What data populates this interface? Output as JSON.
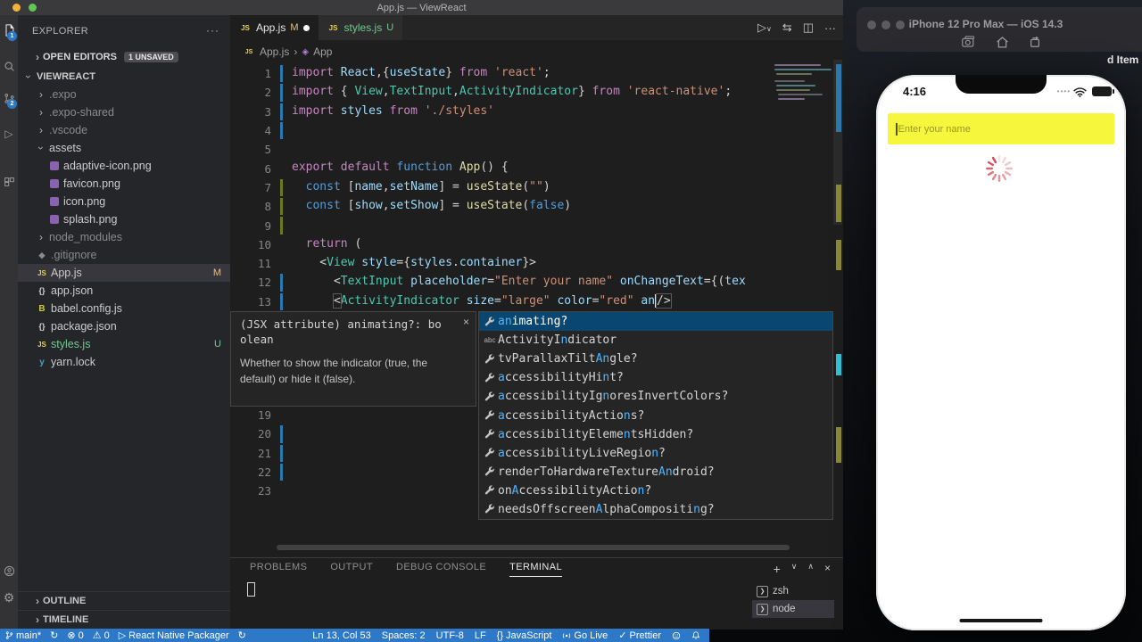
{
  "window": {
    "title": "App.js — ViewReact"
  },
  "colors": {
    "accent": "#2d79c7",
    "selection": "#094771",
    "phone_input_yellow": "#f6f63c",
    "spinner_red": "#cf4a55"
  },
  "activity_bar": {
    "explorer_badge": "1",
    "scm_badge": "2"
  },
  "sidebar": {
    "header": "EXPLORER",
    "open_editors": {
      "label": "OPEN EDITORS",
      "badge": "1 UNSAVED"
    },
    "tree": [
      {
        "label": "VIEWREACT",
        "chev": "open",
        "root": true
      },
      {
        "label": ".expo",
        "chev": "closed",
        "dim": true,
        "indent": 1
      },
      {
        "label": ".expo-shared",
        "chev": "closed",
        "dim": true,
        "indent": 1
      },
      {
        "label": ".vscode",
        "chev": "closed",
        "dim": true,
        "indent": 1
      },
      {
        "label": "assets",
        "chev": "open",
        "indent": 1
      },
      {
        "label": "adaptive-icon.png",
        "icon": "image-icon",
        "indent": 2
      },
      {
        "label": "favicon.png",
        "icon": "image-icon",
        "indent": 2
      },
      {
        "label": "icon.png",
        "icon": "image-icon",
        "indent": 2
      },
      {
        "label": "splash.png",
        "icon": "image-icon",
        "indent": 2
      },
      {
        "label": "node_modules",
        "chev": "closed",
        "dim": true,
        "indent": 1
      },
      {
        "label": ".gitignore",
        "icon": "git-icon",
        "dim": true,
        "indent": 1
      },
      {
        "label": "App.js",
        "icon": "js-icon",
        "selected": true,
        "badge": "M",
        "badge_color": "#e2c08d",
        "indent": 1
      },
      {
        "label": "app.json",
        "icon": "json-icon",
        "indent": 1
      },
      {
        "label": "babel.config.js",
        "icon": "babel-icon",
        "indent": 1
      },
      {
        "label": "package.json",
        "icon": "json-icon",
        "indent": 1
      },
      {
        "label": "styles.js",
        "icon": "js-icon",
        "color": "#73c991",
        "badge": "U",
        "badge_color": "#73c991",
        "indent": 1
      },
      {
        "label": "yarn.lock",
        "icon": "yarn-icon",
        "indent": 1
      }
    ],
    "outline": "OUTLINE",
    "timeline": "TIMELINE"
  },
  "tabs": {
    "tab1": {
      "label": "App.js",
      "badge": "M"
    },
    "tab2": {
      "label": "styles.js",
      "badge": "U"
    }
  },
  "breadcrumb": {
    "file": "App.js",
    "separator": "›",
    "symbol": "App"
  },
  "code": {
    "lines": [
      {
        "n": "1",
        "mk": "mod",
        "segs": [
          [
            "import ",
            "kw"
          ],
          [
            "React",
            "var"
          ],
          [
            ",{",
            "punc"
          ],
          [
            "useState",
            "var"
          ],
          [
            "} ",
            "punc"
          ],
          [
            "from",
            "kw"
          ],
          [
            " ",
            "punc"
          ],
          [
            "'react'",
            "str"
          ],
          [
            ";",
            "punc"
          ]
        ]
      },
      {
        "n": "2",
        "mk": "mod",
        "segs": [
          [
            "import ",
            "kw"
          ],
          [
            "{ ",
            "punc"
          ],
          [
            "View",
            "type"
          ],
          [
            ",",
            "punc"
          ],
          [
            "TextInput",
            "type"
          ],
          [
            ",",
            "punc"
          ],
          [
            "ActivityIndicator",
            "type"
          ],
          [
            "} ",
            "punc"
          ],
          [
            "from",
            "kw"
          ],
          [
            " ",
            "punc"
          ],
          [
            "'react-native'",
            "str"
          ],
          [
            ";",
            "punc"
          ]
        ]
      },
      {
        "n": "3",
        "mk": "mod",
        "segs": [
          [
            "import ",
            "kw"
          ],
          [
            "styles",
            "var"
          ],
          [
            " ",
            "punc"
          ],
          [
            "from",
            "kw"
          ],
          [
            " ",
            "punc"
          ],
          [
            "'./styles'",
            "str"
          ]
        ]
      },
      {
        "n": "4",
        "mk": "mod",
        "segs": []
      },
      {
        "n": "5",
        "segs": []
      },
      {
        "n": "6",
        "segs": [
          [
            "export",
            "kw"
          ],
          [
            " ",
            "punc"
          ],
          [
            "default",
            "kw"
          ],
          [
            " ",
            "punc"
          ],
          [
            "function",
            "ctrl"
          ],
          [
            " ",
            "punc"
          ],
          [
            "App",
            "fn"
          ],
          [
            "() {",
            "punc"
          ]
        ]
      },
      {
        "n": "7",
        "mk": "add",
        "segs": [
          [
            "  ",
            "punc"
          ],
          [
            "const",
            "ctrl"
          ],
          [
            " [",
            "punc"
          ],
          [
            "name",
            "var"
          ],
          [
            ",",
            "punc"
          ],
          [
            "setName",
            "var"
          ],
          [
            "] = ",
            "punc"
          ],
          [
            "useState",
            "fn"
          ],
          [
            "(",
            "punc"
          ],
          [
            "\"\"",
            "str"
          ],
          [
            ")",
            "punc"
          ]
        ]
      },
      {
        "n": "8",
        "mk": "add",
        "segs": [
          [
            "  ",
            "punc"
          ],
          [
            "const",
            "ctrl"
          ],
          [
            " [",
            "punc"
          ],
          [
            "show",
            "var"
          ],
          [
            ",",
            "punc"
          ],
          [
            "setShow",
            "var"
          ],
          [
            "] = ",
            "punc"
          ],
          [
            "useState",
            "fn"
          ],
          [
            "(",
            "punc"
          ],
          [
            "false",
            "ctrl"
          ],
          [
            ")",
            "punc"
          ]
        ]
      },
      {
        "n": "9",
        "mk": "add",
        "segs": []
      },
      {
        "n": "10",
        "segs": [
          [
            "  ",
            "punc"
          ],
          [
            "return",
            "kw"
          ],
          [
            " (",
            "punc"
          ]
        ]
      },
      {
        "n": "11",
        "segs": [
          [
            "    <",
            "punc"
          ],
          [
            "View",
            "type"
          ],
          [
            " ",
            "punc"
          ],
          [
            "style",
            "attr"
          ],
          [
            "={",
            "punc"
          ],
          [
            "styles",
            "var"
          ],
          [
            ".",
            "punc"
          ],
          [
            "container",
            "var"
          ],
          [
            "}>",
            "punc"
          ]
        ]
      },
      {
        "n": "12",
        "mk": "mod",
        "segs": [
          [
            "      <",
            "punc"
          ],
          [
            "TextInput",
            "type"
          ],
          [
            " ",
            "punc"
          ],
          [
            "placeholder",
            "attr"
          ],
          [
            "=",
            "punc"
          ],
          [
            "\"Enter your name\"",
            "str"
          ],
          [
            " ",
            "punc"
          ],
          [
            "onChangeText",
            "attr"
          ],
          [
            "={(",
            "punc"
          ],
          [
            "tex",
            "var"
          ]
        ]
      },
      {
        "n": "13",
        "mk": "mod",
        "segs": [
          [
            "      ",
            "punc"
          ],
          [
            "<",
            "punc",
            "box"
          ],
          [
            "ActivityIndicator",
            "type"
          ],
          [
            " ",
            "punc"
          ],
          [
            "size",
            "attr"
          ],
          [
            "=",
            "punc"
          ],
          [
            "\"large\"",
            "str"
          ],
          [
            " ",
            "punc"
          ],
          [
            "color",
            "attr"
          ],
          [
            "=",
            "punc"
          ],
          [
            "\"red\"",
            "str"
          ],
          [
            " ",
            "punc"
          ],
          [
            "an",
            "attr"
          ],
          [
            "",
            "cursor"
          ],
          [
            "/>",
            "punc",
            "box"
          ]
        ]
      }
    ],
    "gutter_below_popup": [
      {
        "n": "19"
      },
      {
        "n": "20",
        "mk": "mod"
      },
      {
        "n": "21",
        "mk": "mod"
      },
      {
        "n": "22",
        "mk": "mod"
      },
      {
        "n": "23"
      }
    ]
  },
  "tooltip": {
    "signature_line1": "(JSX attribute) animating?: bo",
    "signature_line2": "olean",
    "close": "×",
    "description_line1": "Whether to show the indicator (true, the",
    "description_line2": "default) or hide it (false)."
  },
  "suggest": {
    "items": [
      {
        "icon": "wrench-icon",
        "selected": true,
        "parts": [
          [
            "an",
            1
          ],
          [
            "imating?",
            0
          ]
        ]
      },
      {
        "icon": "abc-icon",
        "parts": [
          [
            "ActivityI",
            0
          ],
          [
            "n",
            1
          ],
          [
            "dicator",
            0
          ]
        ]
      },
      {
        "icon": "wrench-icon",
        "parts": [
          [
            "tvParallaxTilt",
            0
          ],
          [
            "An",
            1
          ],
          [
            "gle?",
            0
          ]
        ]
      },
      {
        "icon": "wrench-icon",
        "parts": [
          [
            "a",
            1
          ],
          [
            "ccessibilityHi",
            0
          ],
          [
            "n",
            1
          ],
          [
            "t?",
            0
          ]
        ]
      },
      {
        "icon": "wrench-icon",
        "parts": [
          [
            "a",
            1
          ],
          [
            "ccessibilityIg",
            0
          ],
          [
            "n",
            1
          ],
          [
            "oresInvertColors?",
            0
          ]
        ]
      },
      {
        "icon": "wrench-icon",
        "parts": [
          [
            "a",
            1
          ],
          [
            "ccessibilityActio",
            0
          ],
          [
            "n",
            1
          ],
          [
            "s?",
            0
          ]
        ]
      },
      {
        "icon": "wrench-icon",
        "parts": [
          [
            "a",
            1
          ],
          [
            "ccessibilityEleme",
            0
          ],
          [
            "n",
            1
          ],
          [
            "tsHidden?",
            0
          ]
        ]
      },
      {
        "icon": "wrench-icon",
        "parts": [
          [
            "a",
            1
          ],
          [
            "ccessibilityLiveRegio",
            0
          ],
          [
            "n",
            1
          ],
          [
            "?",
            0
          ]
        ]
      },
      {
        "icon": "wrench-icon",
        "parts": [
          [
            "renderToHardwareTexture",
            0
          ],
          [
            "An",
            1
          ],
          [
            "droid?",
            0
          ]
        ]
      },
      {
        "icon": "wrench-icon",
        "parts": [
          [
            "on",
            0
          ],
          [
            "A",
            1
          ],
          [
            "ccessibilityActio",
            0
          ],
          [
            "n",
            1
          ],
          [
            "?",
            0
          ]
        ]
      },
      {
        "icon": "wrench-icon",
        "parts": [
          [
            "needsOffscreen",
            0
          ],
          [
            "A",
            1
          ],
          [
            "lphaCompositi",
            0
          ],
          [
            "n",
            1
          ],
          [
            "g?",
            0
          ]
        ]
      }
    ]
  },
  "panel": {
    "tabs": {
      "problems": "PROBLEMS",
      "output": "OUTPUT",
      "debug": "DEBUG CONSOLE",
      "terminal": "TERMINAL"
    },
    "terminals": [
      {
        "label": "zsh"
      },
      {
        "label": "node",
        "selected": true
      }
    ]
  },
  "status_bar": {
    "branch": "main*",
    "errors": "0",
    "warnings": "0",
    "task": "React Native Packager",
    "cursor_pos": "Ln 13, Col 53",
    "spaces": "Spaces: 2",
    "encoding": "UTF-8",
    "eol": "LF",
    "lang_braces": "{}",
    "language": "JavaScript",
    "go_live": "Go Live",
    "prettier_check": "✓",
    "prettier": "Prettier"
  },
  "simulator": {
    "title": "iPhone 12 Pro Max — iOS 14.3",
    "desktop_fragment": "d Item"
  },
  "phone": {
    "time": "4:16",
    "input_placeholder": "Enter your name"
  }
}
